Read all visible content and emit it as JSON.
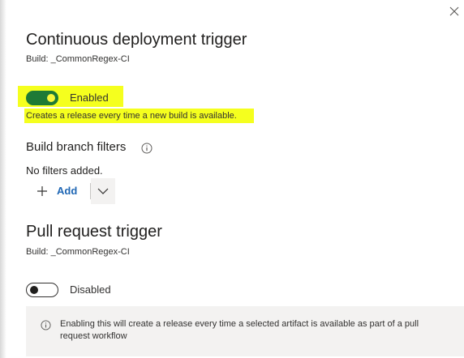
{
  "continuous_deployment": {
    "title": "Continuous deployment trigger",
    "build": "Build: _CommonRegex-CI",
    "toggle_state": "on",
    "toggle_label": "Enabled",
    "description": "Creates a release every time a new build is available."
  },
  "branch_filters": {
    "title": "Build branch filters",
    "empty_text": "No filters added.",
    "add_label": "Add"
  },
  "pull_request": {
    "title": "Pull request trigger",
    "build": "Build: _CommonRegex-CI",
    "toggle_state": "off",
    "toggle_label": "Disabled",
    "info_text": "Enabling this will create a release every time a selected artifact is available as part of a pull request workflow"
  },
  "icons": [
    "close-icon",
    "info-icon",
    "plus-icon",
    "chevron-down-icon"
  ],
  "colors": {
    "highlight": "#f5ff1e",
    "toggle_on": "#1e7a36",
    "link_blue": "#1e66b4",
    "info_bg": "#f3f2f1"
  }
}
